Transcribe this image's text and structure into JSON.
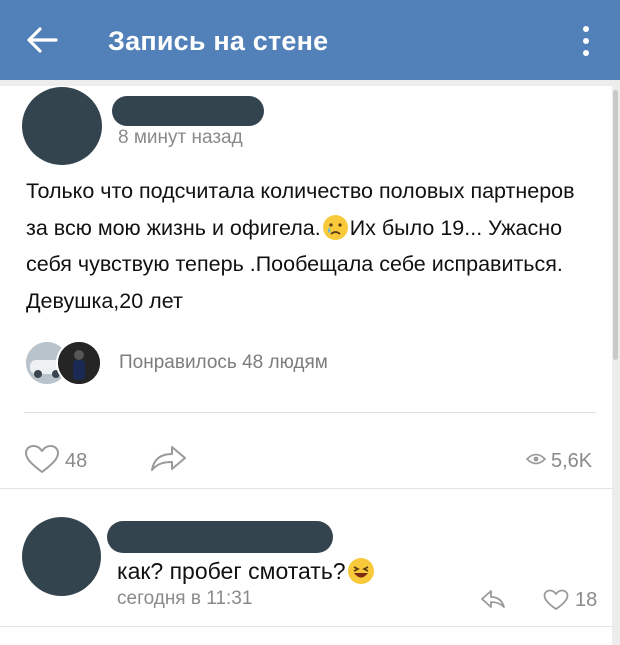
{
  "header": {
    "title": "Запись на стене",
    "back_icon": "arrow-left-icon",
    "more_icon": "more-vertical-icon",
    "bg_color": "#5181b8"
  },
  "post": {
    "time": "8 минут назад",
    "text": "Только что подсчитала количество половых партнеров за всю мою жизнь и офигела.",
    "text_after_emoji": "Их было 19... Ужасно себя чувствую теперь .Пообещала себе исправиться. Девушка,20 лет",
    "emoji": "crying-face-emoji",
    "liked_by_text": "Понравилось 48 людям",
    "likes_count": "48",
    "views_count": "5,6K"
  },
  "comment": {
    "text": "как? пробег смотать?",
    "emoji": "laughing-face-emoji",
    "time": "сегодня в 11:31",
    "likes_count": "18"
  }
}
